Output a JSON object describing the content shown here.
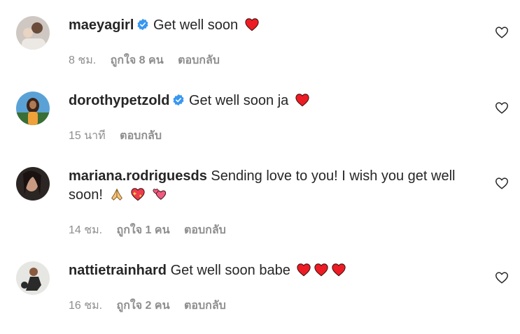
{
  "colors": {
    "text": "#262626",
    "meta": "#8e8e8e",
    "verified": "#3897f0",
    "heart": "#ed1c24"
  },
  "comments": [
    {
      "username": "maeyagirl",
      "verified": true,
      "text": "Get well soon",
      "emojis": [
        "red-heart"
      ],
      "time": "8 ชม.",
      "likes": "ถูกใจ 8 คน",
      "reply": "ตอบกลับ"
    },
    {
      "username": "dorothypetzold",
      "verified": true,
      "text": "Get well soon ja",
      "emojis": [
        "red-heart"
      ],
      "time": "15 นาที",
      "likes": "",
      "reply": "ตอบกลับ"
    },
    {
      "username": "mariana.rodriguesds",
      "verified": false,
      "text_line1": "Sending love to you! I wish you get well",
      "text_line2": "soon!",
      "emojis": [
        "folded-hands",
        "sparkling-heart",
        "revolving-hearts"
      ],
      "time": "14 ชม.",
      "likes": "ถูกใจ 1 คน",
      "reply": "ตอบกลับ"
    },
    {
      "username": "nattietrainhard",
      "verified": false,
      "text": "Get well soon babe",
      "emojis": [
        "red-heart",
        "red-heart",
        "red-heart"
      ],
      "time": "16 ชม.",
      "likes": "ถูกใจ 2 คน",
      "reply": "ตอบกลับ"
    }
  ]
}
